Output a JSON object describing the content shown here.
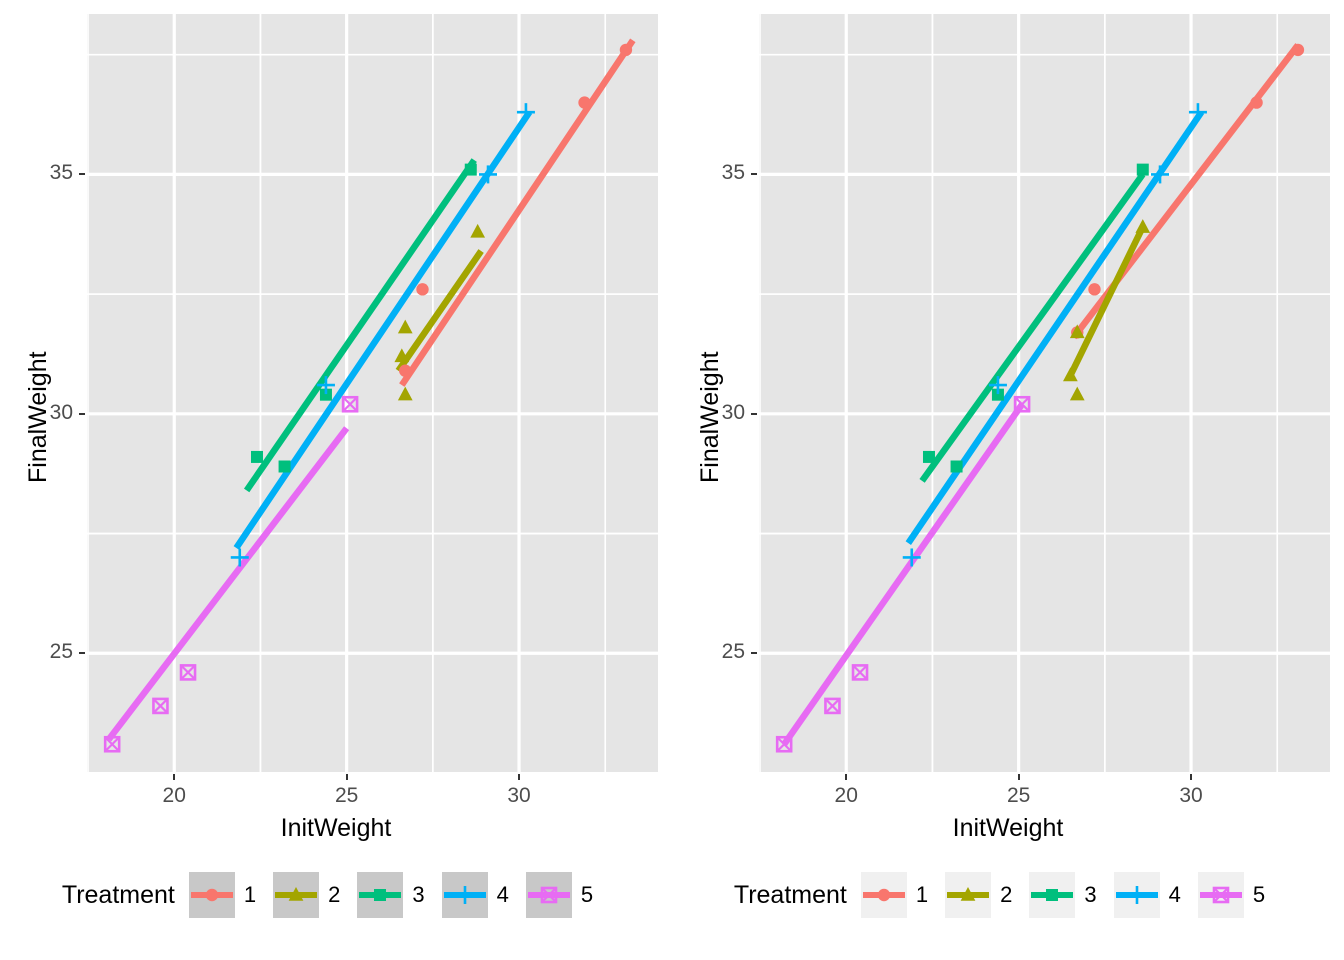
{
  "figure": {
    "type": "multi-panel-scatter-with-regression",
    "panel_count": 2,
    "background": "#FFFFFF",
    "panel_background": "#E5E5E5",
    "grid_color": "#FFFFFF"
  },
  "chart_data": [
    {
      "type": "scatter",
      "panel": "left",
      "title": "",
      "xlabel": "InitWeight",
      "ylabel": "FinalWeight",
      "xlim": [
        17.47,
        34.03
      ],
      "ylim": [
        22.52,
        38.35
      ],
      "xticks": [
        20,
        25,
        30
      ],
      "yticks": [
        25,
        30,
        35
      ],
      "xtick_labels": [
        "20",
        "25",
        "30"
      ],
      "ytick_labels": [
        "25",
        "30",
        "35"
      ],
      "grid": "major-and-minor",
      "legend_position": "bottom",
      "legend_title": "Treatment",
      "legend_key_fill": "#C8C8C8",
      "fit_note": "common-slope (parallel) regression lines",
      "series": [
        {
          "name": "1",
          "color": "#F8766D",
          "marker": "circle",
          "points": [
            [
              26.7,
              30.9
            ],
            [
              27.2,
              32.6
            ],
            [
              31.9,
              36.5
            ],
            [
              33.1,
              37.6
            ]
          ],
          "line": [
            [
              26.6,
              30.6
            ],
            [
              33.3,
              37.8
            ]
          ]
        },
        {
          "name": "2",
          "color": "#A3A500",
          "marker": "triangle",
          "points": [
            [
              26.6,
              31.2
            ],
            [
              26.7,
              30.4
            ],
            [
              26.7,
              31.8
            ],
            [
              28.8,
              33.8
            ]
          ],
          "line": [
            [
              26.5,
              30.9
            ],
            [
              28.9,
              33.4
            ]
          ]
        },
        {
          "name": "3",
          "color": "#00BF7D",
          "marker": "square",
          "points": [
            [
              22.4,
              29.1
            ],
            [
              23.2,
              28.9
            ],
            [
              24.4,
              30.4
            ],
            [
              28.6,
              35.1
            ]
          ],
          "line": [
            [
              22.1,
              28.4
            ],
            [
              28.7,
              35.3
            ]
          ]
        },
        {
          "name": "4",
          "color": "#00B0F6",
          "marker": "plus",
          "points": [
            [
              21.9,
              27.0
            ],
            [
              24.4,
              30.6
            ],
            [
              29.1,
              35.0
            ],
            [
              30.2,
              36.3
            ]
          ],
          "line": [
            [
              21.8,
              27.2
            ],
            [
              30.3,
              36.3
            ]
          ]
        },
        {
          "name": "5",
          "color": "#E76BF3",
          "marker": "square-x",
          "points": [
            [
              18.2,
              23.1
            ],
            [
              19.6,
              23.9
            ],
            [
              20.4,
              24.6
            ],
            [
              25.1,
              30.2
            ]
          ],
          "line": [
            [
              18.1,
              23.2
            ],
            [
              25.0,
              29.7
            ]
          ]
        }
      ]
    },
    {
      "type": "scatter",
      "panel": "right",
      "title": "",
      "xlabel": "InitWeight",
      "ylabel": "FinalWeight",
      "xlim": [
        17.47,
        34.03
      ],
      "ylim": [
        22.52,
        38.35
      ],
      "xticks": [
        20,
        25,
        30
      ],
      "yticks": [
        25,
        30,
        35
      ],
      "xtick_labels": [
        "20",
        "25",
        "30"
      ],
      "ytick_labels": [
        "25",
        "30",
        "35"
      ],
      "grid": "major-and-minor",
      "legend_position": "bottom",
      "legend_title": "Treatment",
      "legend_key_fill": "#F0F0F0",
      "fit_note": "separate-slope regression lines fitted per treatment",
      "series": [
        {
          "name": "1",
          "color": "#F8766D",
          "marker": "circle",
          "points": [
            [
              26.7,
              31.7
            ],
            [
              27.2,
              32.6
            ],
            [
              31.9,
              36.5
            ],
            [
              33.1,
              37.6
            ]
          ],
          "line": [
            [
              26.6,
              31.6
            ],
            [
              33.1,
              37.7
            ]
          ]
        },
        {
          "name": "2",
          "color": "#A3A500",
          "marker": "triangle",
          "points": [
            [
              26.5,
              30.8
            ],
            [
              26.7,
              30.4
            ],
            [
              26.7,
              31.7
            ],
            [
              28.6,
              33.9
            ]
          ],
          "line": [
            [
              26.5,
              30.8
            ],
            [
              28.6,
              33.9
            ]
          ]
        },
        {
          "name": "3",
          "color": "#00BF7D",
          "marker": "square",
          "points": [
            [
              22.4,
              29.1
            ],
            [
              23.2,
              28.9
            ],
            [
              24.4,
              30.4
            ],
            [
              28.6,
              35.1
            ]
          ],
          "line": [
            [
              22.2,
              28.6
            ],
            [
              28.6,
              35.0
            ]
          ]
        },
        {
          "name": "4",
          "color": "#00B0F6",
          "marker": "plus",
          "points": [
            [
              21.9,
              27.0
            ],
            [
              24.4,
              30.6
            ],
            [
              29.1,
              35.0
            ],
            [
              30.2,
              36.3
            ]
          ],
          "line": [
            [
              21.8,
              27.3
            ],
            [
              30.3,
              36.3
            ]
          ]
        },
        {
          "name": "5",
          "color": "#E76BF3",
          "marker": "square-x",
          "points": [
            [
              18.2,
              23.1
            ],
            [
              19.6,
              23.9
            ],
            [
              20.4,
              24.6
            ],
            [
              25.1,
              30.2
            ]
          ],
          "line": [
            [
              18.2,
              23.1
            ],
            [
              25.1,
              30.2
            ]
          ]
        }
      ]
    }
  ],
  "panels": [
    {
      "id": "left",
      "axis_title_x": "InitWeight",
      "axis_title_y": "FinalWeight",
      "ytick_labels": [
        "35",
        "30",
        "25"
      ],
      "xtick_labels": [
        "20",
        "25",
        "30"
      ],
      "legend": {
        "title": "Treatment",
        "key_fill": "#C8C8C8",
        "items": [
          {
            "label": "1",
            "color": "#F8766D",
            "marker": "circle"
          },
          {
            "label": "2",
            "color": "#A3A500",
            "marker": "triangle"
          },
          {
            "label": "3",
            "color": "#00BF7D",
            "marker": "square"
          },
          {
            "label": "4",
            "color": "#00B0F6",
            "marker": "plus"
          },
          {
            "label": "5",
            "color": "#E76BF3",
            "marker": "square-x"
          }
        ]
      }
    },
    {
      "id": "right",
      "axis_title_x": "InitWeight",
      "axis_title_y": "FinalWeight",
      "ytick_labels": [
        "35",
        "30",
        "25"
      ],
      "xtick_labels": [
        "20",
        "25",
        "30"
      ],
      "legend": {
        "title": "Treatment",
        "key_fill": "#F0F0F0",
        "items": [
          {
            "label": "1",
            "color": "#F8766D",
            "marker": "circle"
          },
          {
            "label": "2",
            "color": "#A3A500",
            "marker": "triangle"
          },
          {
            "label": "3",
            "color": "#00BF7D",
            "marker": "square"
          },
          {
            "label": "4",
            "color": "#00B0F6",
            "marker": "plus"
          },
          {
            "label": "5",
            "color": "#E76BF3",
            "marker": "square-x"
          }
        ]
      }
    }
  ]
}
